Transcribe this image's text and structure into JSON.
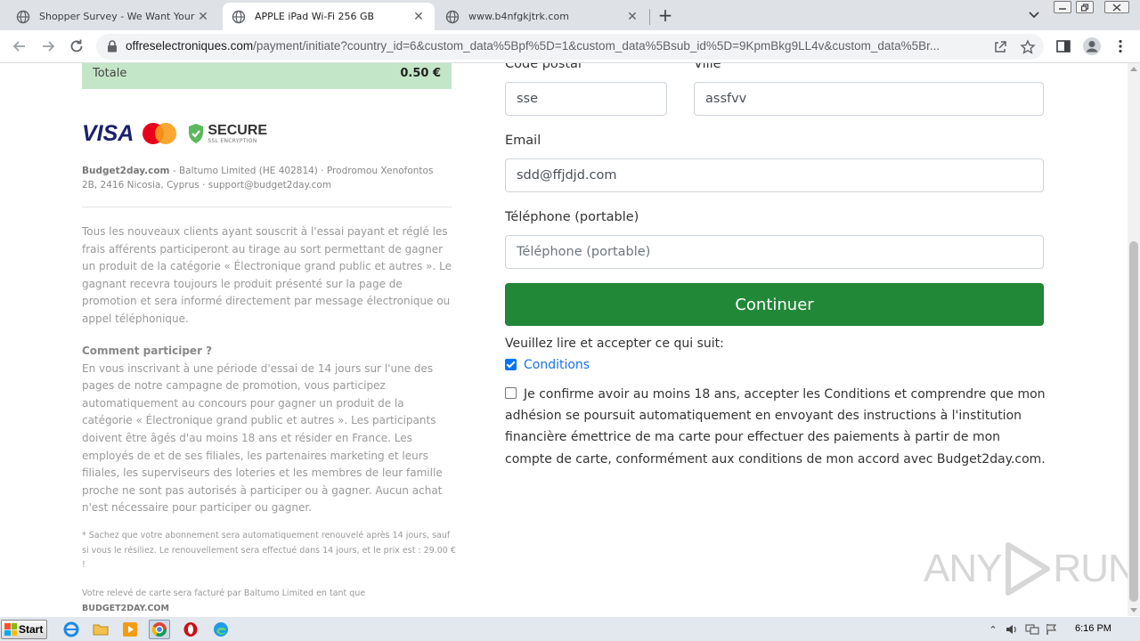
{
  "browser": {
    "tabs": [
      {
        "title": "Shopper Survey - We Want Your Opinion",
        "active": false
      },
      {
        "title": "APPLE iPad Wi-Fi 256 GB",
        "active": true
      },
      {
        "title": "www.b4nfgkjtrk.com",
        "active": false
      }
    ],
    "url_host": "offreselectroniques.com",
    "url_path": "/payment/initiate?country_id=6&custom_data%5Bpf%5D=1&custom_data%5Bsub_id%5D=9KpmBkg9LL4v&custom_data%5Br..."
  },
  "order": {
    "total_label": "Totale",
    "total_value": "0.50 €"
  },
  "badges": {
    "visa": "VISA",
    "secure_title": "SECURE",
    "secure_subtitle": "SSL ENCRYPTION"
  },
  "company": {
    "name": "Budget2day.com",
    "details": " - Baltumo Limited (HE 402814) · Prodromou Xenofontos 2B, 2416 Nicosia, Cyprus · support@budget2day.com"
  },
  "info": {
    "para1": "Tous les nouveaux clients ayant souscrit à l'essai payant et réglé les frais afférents participeront au tirage au sort permettant de gagner un produit de la catégorie « Électronique grand public et autres ». Le gagnant recevra toujours le produit présenté sur la page de promotion et sera informé directement par message électronique ou appel téléphonique.",
    "how_title": "Comment participer ?",
    "para2": "En vous inscrivant à une période d'essai de 14 jours sur l'une des pages de notre campagne de promotion, vous participez automatiquement au concours pour gagner un produit de la catégorie « Électronique grand public et autres ». Les participants doivent être âgés d'au moins 18 ans et résider en France. Les employés de et de ses filiales, les partenaires marketing et leurs filiales, les superviseurs des loteries et les membres de leur famille proche ne sont pas autorisés à participer ou à gagner. Aucun achat n'est nécessaire pour participer ou gagner.",
    "note": "* Sachez que votre abonnement sera automatiquement renouvelé après 14 jours, sauf si vous le résiliez. Le renouvellement sera effectué dans 14 jours, et le prix est : 29.00 € !",
    "billing_prefix": "Votre relevé de carte sera facturé par Baltumo Limited en tant que",
    "billing_name": "BUDGET2DAY.COM"
  },
  "form": {
    "postal_label": "Code postal",
    "postal_value": "sse",
    "city_label": "Ville",
    "city_value": "assfvv",
    "email_label": "Email",
    "email_value": "sdd@ffjdjd.com",
    "phone_label": "Téléphone (portable)",
    "phone_placeholder": "Téléphone (portable)",
    "continue_label": "Continuer",
    "instructions": "Veuillez lire et accepter ce qui suit:",
    "conditions_label": "Conditions",
    "confirm_text": "Je confirme avoir au moins 18 ans, accepter les Conditions et comprendre que mon adhésion se poursuit automatiquement en envoyant des instructions à l'institution financière émettrice de ma carte pour effectuer des paiements à partir de mon compte de carte, conformément aux conditions de mon accord avec Budget2day.com."
  },
  "watermark": {
    "left": "ANY",
    "right": "RUN"
  },
  "taskbar": {
    "start_label": "Start",
    "clock": "6:16 PM"
  },
  "icons": {
    "tab_favicon": "globe-icon",
    "new_tab": "plus-icon",
    "back": "arrow-left-icon",
    "forward": "arrow-right-icon",
    "reload": "reload-icon",
    "lock": "lock-icon",
    "share": "share-icon",
    "bookmark": "star-icon",
    "sidepanel": "side-panel-icon",
    "profile": "profile-icon",
    "menu": "kebab-menu-icon"
  },
  "colors": {
    "primary_button": "#218838",
    "total_bg": "#c4e6c8",
    "link": "#1a73e8",
    "checkbox": "#0075ff"
  }
}
